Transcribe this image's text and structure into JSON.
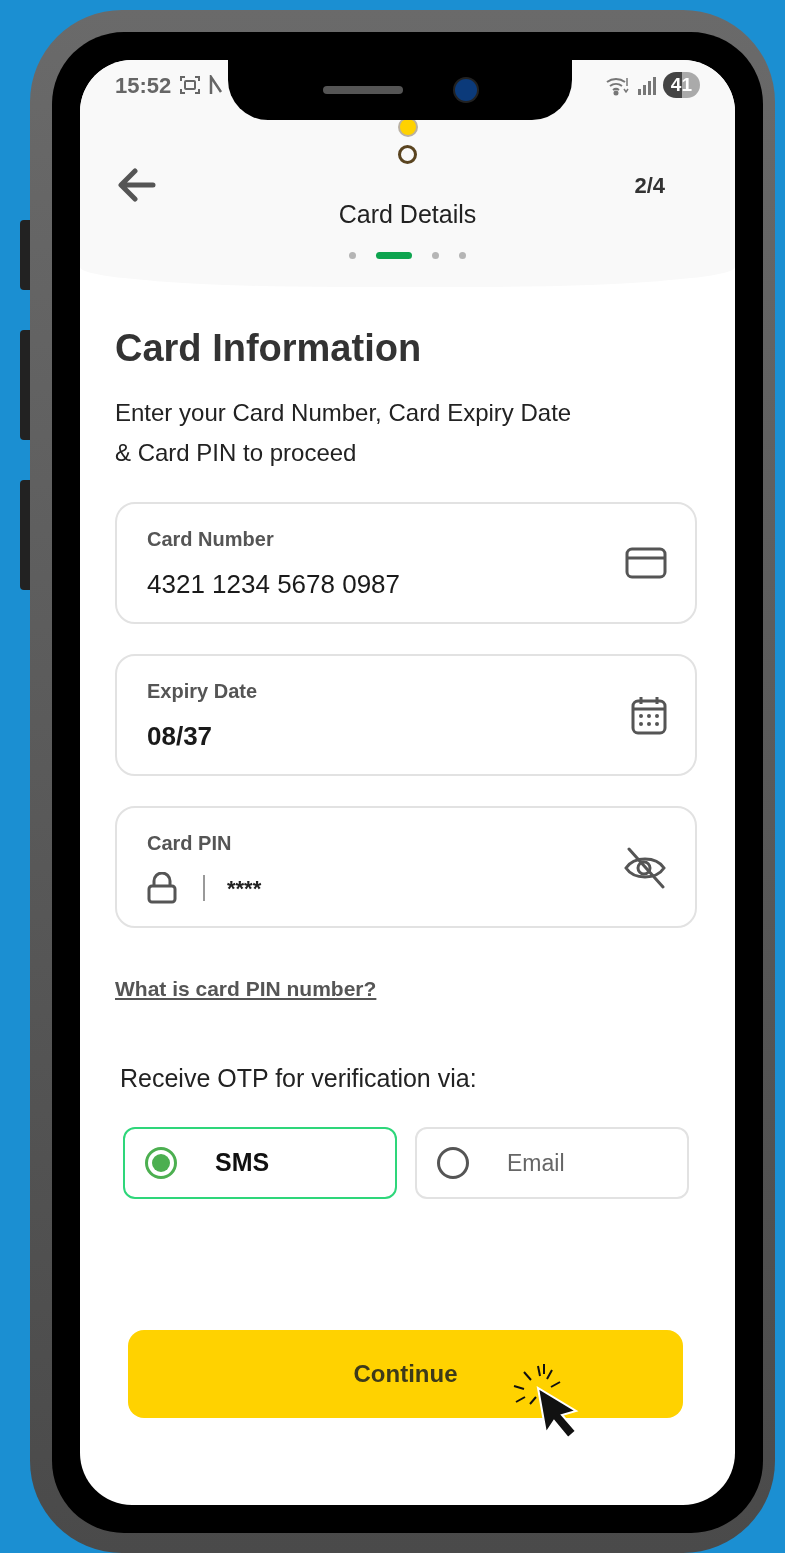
{
  "status_bar": {
    "time": "15:52",
    "battery": "41"
  },
  "header": {
    "title": "Card Details",
    "step_counter": "2/4",
    "steps": [
      {
        "selected": false
      },
      {
        "selected": true
      },
      {
        "selected": false
      },
      {
        "selected": false
      }
    ]
  },
  "heading": "Card Information",
  "instructions": "Enter your Card Number, Card Expiry Date & Card PIN to proceed",
  "fields": [
    {
      "kind": "card",
      "label": "Card Number",
      "value": "4321 1234 5678 0987"
    },
    {
      "kind": "date",
      "label": "Expiry Date",
      "value": "08/37"
    },
    {
      "kind": "pin",
      "label": "Card PIN",
      "value": "****"
    }
  ],
  "help_link": "What is card PIN number?",
  "otp": {
    "label": "Receive OTP for verification via:",
    "options": [
      {
        "label": "SMS",
        "selected": true
      },
      {
        "label": "Email",
        "selected": false
      }
    ]
  },
  "continue_button": "Continue"
}
